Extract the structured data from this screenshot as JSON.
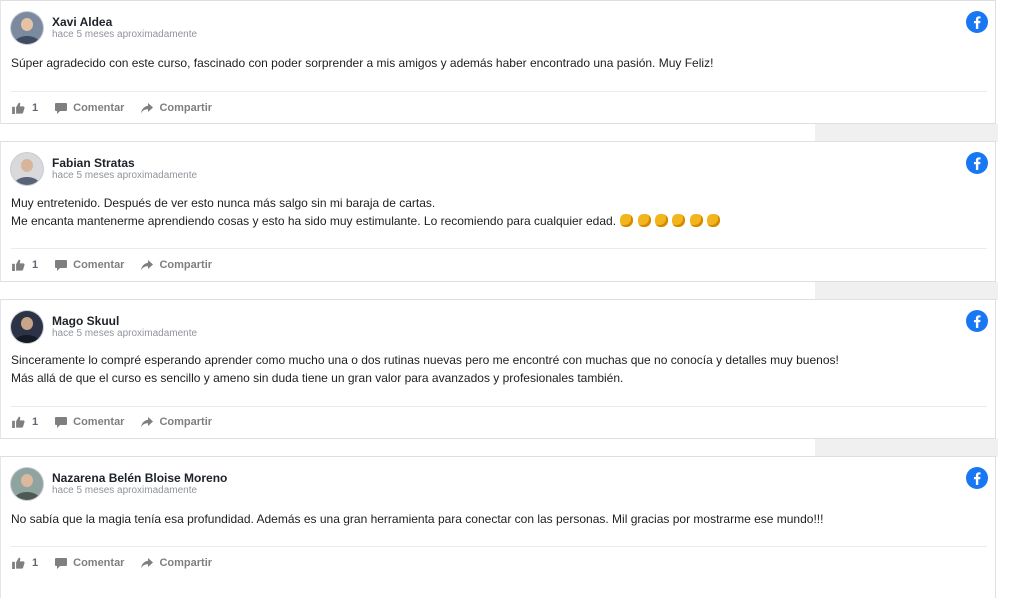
{
  "posts": [
    {
      "author": "Xavi Aldea",
      "time": "hace 5 meses aproximadamente",
      "lines": [
        "Súper agradecido con este curso, fascinado con poder sorprender a mis amigos y además haber encontrado una pasión. Muy Feliz!"
      ],
      "likes": "1",
      "comment_label": "Comentar",
      "share_label": "Compartir"
    },
    {
      "author": "Fabian Stratas",
      "time": "hace 5 meses aproximadamente",
      "lines": [
        "Muy entretenido. Después de ver esto nunca más salgo sin mi baraja de cartas.",
        "Me encanta mantenerme aprendiendo cosas y esto ha sido muy estimulante. Lo recomiendo para cualquier edad."
      ],
      "emoji": "clapping-hands-emoji",
      "emoji_count": 6,
      "likes": "1",
      "comment_label": "Comentar",
      "share_label": "Compartir"
    },
    {
      "author": "Mago Skuul",
      "time": "hace 5 meses aproximadamente",
      "lines": [
        "Sinceramente lo compré esperando aprender como mucho una o dos rutinas nuevas pero me encontré con muchas que no conocía y detalles muy buenos!",
        "Más allá de que el curso es sencillo y ameno sin duda tiene un gran valor para avanzados y profesionales también."
      ],
      "likes": "1",
      "comment_label": "Comentar",
      "share_label": "Compartir"
    },
    {
      "author": "Nazarena Belén Bloise Moreno",
      "time": "hace 5 meses aproximadamente",
      "lines": [
        "No sabía que la magia tenía esa profundidad. Además es una gran herramienta para conectar con las personas. Mil gracias por mostrarme ese mundo!!!"
      ],
      "likes": "1",
      "comment_label": "Comentar",
      "share_label": "Compartir"
    }
  ],
  "icons": {
    "brand": "facebook-icon",
    "like": "thumbs-up-icon",
    "comment": "comment-icon",
    "share": "share-arrow-icon"
  },
  "colors": {
    "facebook_blue": "#1877f2",
    "action_gray": "#7f7f7f",
    "time_gray": "#90949c"
  }
}
